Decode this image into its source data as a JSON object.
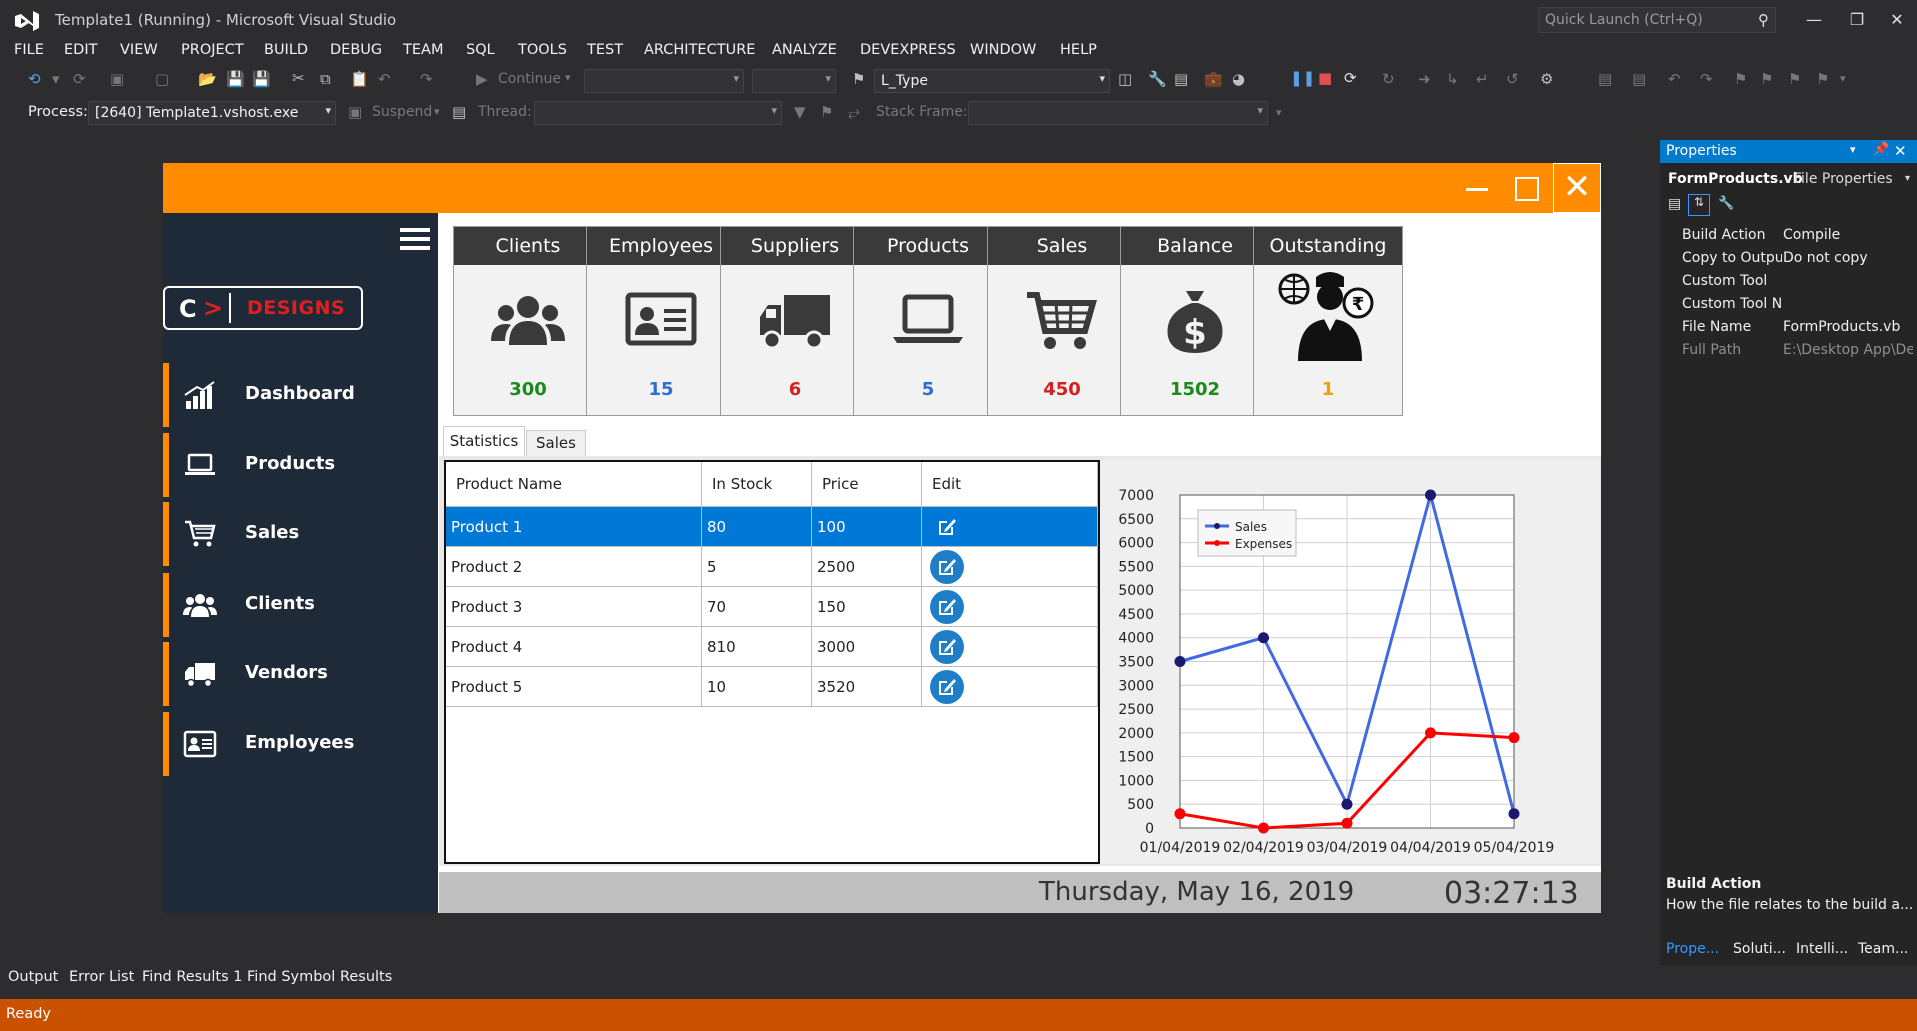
{
  "vs": {
    "title": "Template1 (Running) - Microsoft Visual Studio",
    "quick_launch_placeholder": "Quick Launch (Ctrl+Q)",
    "menu": [
      "FILE",
      "EDIT",
      "VIEW",
      "PROJECT",
      "BUILD",
      "DEBUG",
      "TEAM",
      "SQL",
      "TOOLS",
      "TEST",
      "ARCHITECTURE",
      "ANALYZE",
      "DEVEXPRESS",
      "WINDOW",
      "HELP"
    ],
    "toolbar": {
      "continue_label": "Continue",
      "type_combo_value": "L_Type",
      "process_label": "Process:",
      "process_value": "[2640] Template1.vshost.exe",
      "suspend_label": "Suspend",
      "thread_label": "Thread:",
      "stack_frame_label": "Stack Frame:"
    },
    "bottom_tabs": [
      "Output",
      "Error List",
      "Find Results 1",
      "Find Symbol Results"
    ],
    "status": "Ready",
    "colors": {
      "accent": "#007acc",
      "statusbar": "#ca5100"
    }
  },
  "properties": {
    "title": "Properties",
    "file_name": "FormProducts.vb",
    "file_kind": "File Properties",
    "rows": [
      {
        "key": "Build Action",
        "value": "Compile"
      },
      {
        "key": "Copy to Output",
        "value": "Do not copy"
      },
      {
        "key": "Custom Tool",
        "value": ""
      },
      {
        "key": "Custom Tool Namespace",
        "value": ""
      },
      {
        "key": "File Name",
        "value": "FormProducts.vb"
      },
      {
        "key": "Full Path",
        "value": "E:\\Desktop App\\De"
      }
    ],
    "desc_title": "Build Action",
    "desc_text": "How the file relates to the build a...",
    "tabs": [
      "Prope...",
      "Soluti...",
      "Intelli...",
      "Team..."
    ]
  },
  "app": {
    "colors": {
      "titlebar": "#ff8c00",
      "sidebar": "#1f2a38",
      "selection": "#0078d7"
    },
    "logo": {
      "c": "C",
      "text": "DESIGNS"
    },
    "nav": [
      {
        "label": "Dashboard",
        "icon": "chart-bars-icon"
      },
      {
        "label": "Products",
        "icon": "laptop-icon"
      },
      {
        "label": "Sales",
        "icon": "cart-icon"
      },
      {
        "label": "Clients",
        "icon": "users-icon"
      },
      {
        "label": "Vendors",
        "icon": "truck-icon"
      },
      {
        "label": "Employees",
        "icon": "id-card-icon"
      }
    ],
    "cards": [
      {
        "title": "Clients",
        "value": "300",
        "color": "#1a8a1a",
        "icon": "users-icon"
      },
      {
        "title": "Employees",
        "value": "15",
        "color": "#2b6fd6",
        "icon": "id-card-icon"
      },
      {
        "title": "Suppliers",
        "value": "6",
        "color": "#d62020",
        "icon": "truck-icon"
      },
      {
        "title": "Products",
        "value": "5",
        "color": "#2b6fd6",
        "icon": "laptop-icon"
      },
      {
        "title": "Sales",
        "value": "450",
        "color": "#d62020",
        "icon": "cart-icon"
      },
      {
        "title": "Balance",
        "value": "1502",
        "color": "#1a8a1a",
        "icon": "money-bag-icon"
      },
      {
        "title": "Outstanding",
        "value": "1",
        "color": "#f0a000",
        "icon": "debtor-icon"
      }
    ],
    "tabs": [
      "Statistics",
      "Sales"
    ],
    "grid": {
      "columns": [
        "Product Name",
        "In Stock",
        "Price",
        "Edit"
      ],
      "rows": [
        [
          "Product 1",
          "80",
          "100"
        ],
        [
          "Product 2",
          "5",
          "2500"
        ],
        [
          "Product 3",
          "70",
          "150"
        ],
        [
          "Product 4",
          "810",
          "3000"
        ],
        [
          "Product 5",
          "10",
          "3520"
        ]
      ],
      "selected_row": 0
    },
    "date": "Thursday, May 16, 2019",
    "time": "03:27:13"
  },
  "chart_data": {
    "type": "line",
    "x": [
      "01/04/2019",
      "02/04/2019",
      "03/04/2019",
      "04/04/2019",
      "05/04/2019"
    ],
    "series": [
      {
        "name": "Sales",
        "values": [
          3500,
          4000,
          500,
          7000,
          300
        ],
        "color": "#4169e1",
        "marker": "#191970"
      },
      {
        "name": "Expenses",
        "values": [
          300,
          0,
          100,
          2000,
          1900
        ],
        "color": "#ff0000",
        "marker": "#ff0000"
      }
    ],
    "yticks": [
      0,
      500,
      1000,
      1500,
      2000,
      2500,
      3000,
      3500,
      4000,
      4500,
      5000,
      5500,
      6000,
      6500,
      7000
    ],
    "ylim": [
      0,
      7000
    ],
    "grid": true,
    "legend": "top-left"
  }
}
